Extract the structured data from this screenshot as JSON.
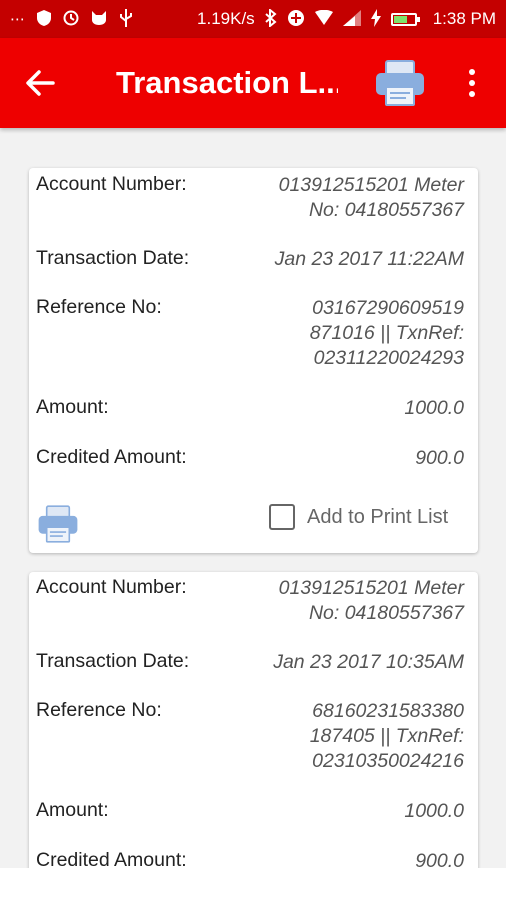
{
  "status_bar": {
    "left_icons": [
      "more-icon",
      "shield-icon",
      "clock-icon",
      "cat-icon",
      "usb-icon"
    ],
    "network_speed": "1.19K/s",
    "right_icons": [
      "bluetooth-icon",
      "data-saver-icon",
      "wifi-icon",
      "signal-icon",
      "charging-icon",
      "battery-icon"
    ],
    "time": "1:38 PM"
  },
  "app_bar": {
    "title": "Transaction L...",
    "back_icon": "arrow-left-icon",
    "print_icon": "printer-icon",
    "more_icon": "more-vertical-icon"
  },
  "colors": {
    "status_bar": "#c40000",
    "app_bar": "#ee0000",
    "printer_blue": "#8aaede"
  },
  "transactions": [
    {
      "account_label": "Account Number:",
      "account_value": "013912515201 Meter\nNo: 04180557367",
      "date_label": "Transaction Date:",
      "date_value": "Jan 23 2017 11:22AM",
      "reference_label": "Reference No:",
      "reference_value": "03167290609519\n871016 || TxnRef:\n02311220024293",
      "amount_label": "Amount:",
      "amount_value": "1000.0",
      "credited_label": "Credited Amount:",
      "credited_value": "900.0",
      "add_to_print_label": "Add to  Print List",
      "add_to_print_checked": false
    },
    {
      "account_label": "Account Number:",
      "account_value": "013912515201 Meter\nNo: 04180557367",
      "date_label": "Transaction Date:",
      "date_value": "Jan 23 2017 10:35AM",
      "reference_label": "Reference No:",
      "reference_value": "68160231583380\n187405 || TxnRef:\n02310350024216",
      "amount_label": "Amount:",
      "amount_value": "1000.0",
      "credited_label": "Credited Amount:",
      "credited_value": "900.0"
    }
  ]
}
